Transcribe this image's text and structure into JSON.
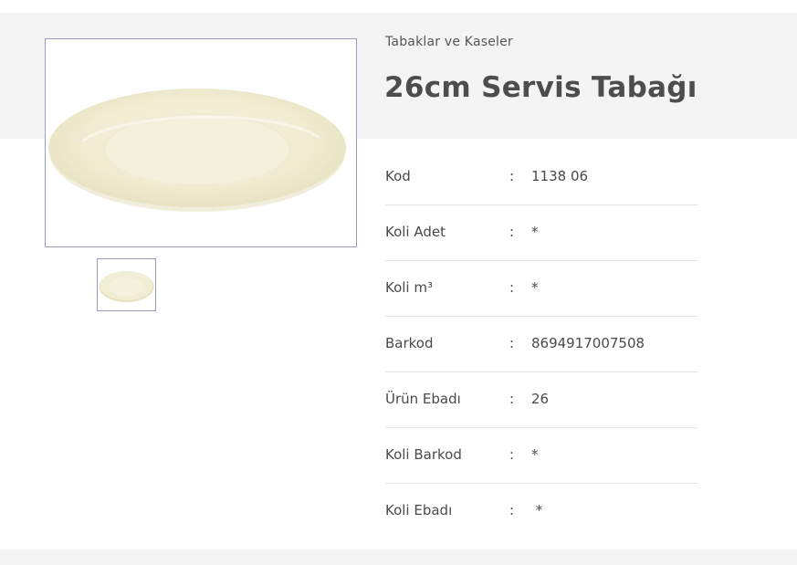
{
  "product": {
    "category": "Tabaklar ve Kaseler",
    "title": "26cm Servis Tabağı",
    "image_icon": "plate-image",
    "thumbnail_icon": "plate-thumbnail"
  },
  "specs": [
    {
      "label": "Kod",
      "sep": ":",
      "value": "1138 06"
    },
    {
      "label": "Koli Adet",
      "sep": ":",
      "value": "*"
    },
    {
      "label": "Koli m³",
      "sep": ":",
      "value": "*"
    },
    {
      "label": "Barkod",
      "sep": ":",
      "value": "8694917007508"
    },
    {
      "label": "Ürün Ebadı",
      "sep": ":",
      "value": "26"
    },
    {
      "label": "Koli Barkod",
      "sep": ":",
      "value": "*"
    },
    {
      "label": "Koli Ebadı",
      "sep": ":",
      "value": " *"
    }
  ],
  "colors": {
    "band": "#f4f4f4",
    "image_border": "#9a9cc8",
    "plate": "#f3efd8",
    "text": "#4a4a4a"
  }
}
